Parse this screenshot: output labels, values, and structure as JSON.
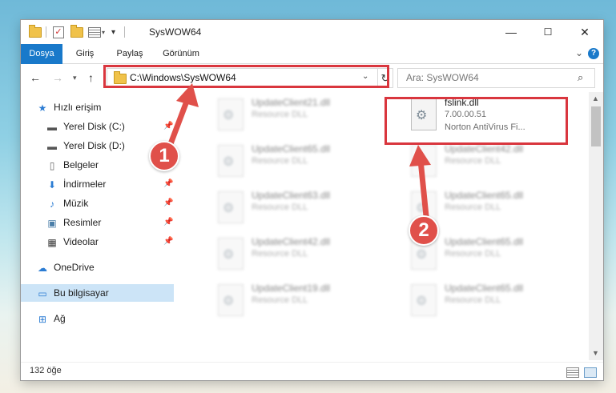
{
  "window": {
    "title": "SysWOW64",
    "controls": {
      "minimize": "—",
      "maximize": "☐",
      "close": "✕"
    }
  },
  "ribbon": {
    "tabs": [
      "Dosya",
      "Giriş",
      "Paylaş",
      "Görünüm"
    ],
    "help": "?"
  },
  "address": {
    "path": "C:\\Windows\\SysWOW64",
    "search_placeholder": "Ara: SysWOW64"
  },
  "sidebar": {
    "items": [
      {
        "label": "Hızlı erişim",
        "icon": "star-icon"
      },
      {
        "label": "Yerel Disk (C:)",
        "icon": "drive-icon"
      },
      {
        "label": "Yerel Disk (D:)",
        "icon": "drive-icon"
      },
      {
        "label": "Belgeler",
        "icon": "documents-icon"
      },
      {
        "label": "İndirmeler",
        "icon": "download-icon"
      },
      {
        "label": "Müzik",
        "icon": "music-icon"
      },
      {
        "label": "Resimler",
        "icon": "pictures-icon"
      },
      {
        "label": "Videolar",
        "icon": "videos-icon"
      },
      {
        "label": "OneDrive",
        "icon": "cloud-icon"
      },
      {
        "label": "Bu bilgisayar",
        "icon": "computer-icon"
      },
      {
        "label": "Ağ",
        "icon": "network-icon"
      }
    ]
  },
  "files": {
    "left": [
      {
        "name": "UpdateClient21.dll",
        "desc": "Resource DLL"
      },
      {
        "name": "UpdateClient65.dll",
        "desc": "Resource DLL"
      },
      {
        "name": "UpdateClient63.dll",
        "desc": "Resource DLL"
      },
      {
        "name": "UpdateClient42.dll",
        "desc": "Resource DLL"
      },
      {
        "name": "UpdateClient19.dll",
        "desc": "Resource DLL"
      }
    ],
    "highlighted": {
      "name": "fslink.dll",
      "version": "7.00.00.51",
      "company": "Norton AntiVirus Fi..."
    },
    "right": [
      {
        "name": "UpdateClient42.dll",
        "desc": "Resource DLL"
      },
      {
        "name": "UpdateClient65.dll",
        "desc": "Resource DLL"
      },
      {
        "name": "UpdateClient65.dll",
        "desc": "Resource DLL"
      },
      {
        "name": "UpdateClient65.dll",
        "desc": "Resource DLL"
      }
    ]
  },
  "status": {
    "count": "132 öğe"
  },
  "annotations": {
    "badge1": "1",
    "badge2": "2",
    "color": "#d9363e"
  }
}
